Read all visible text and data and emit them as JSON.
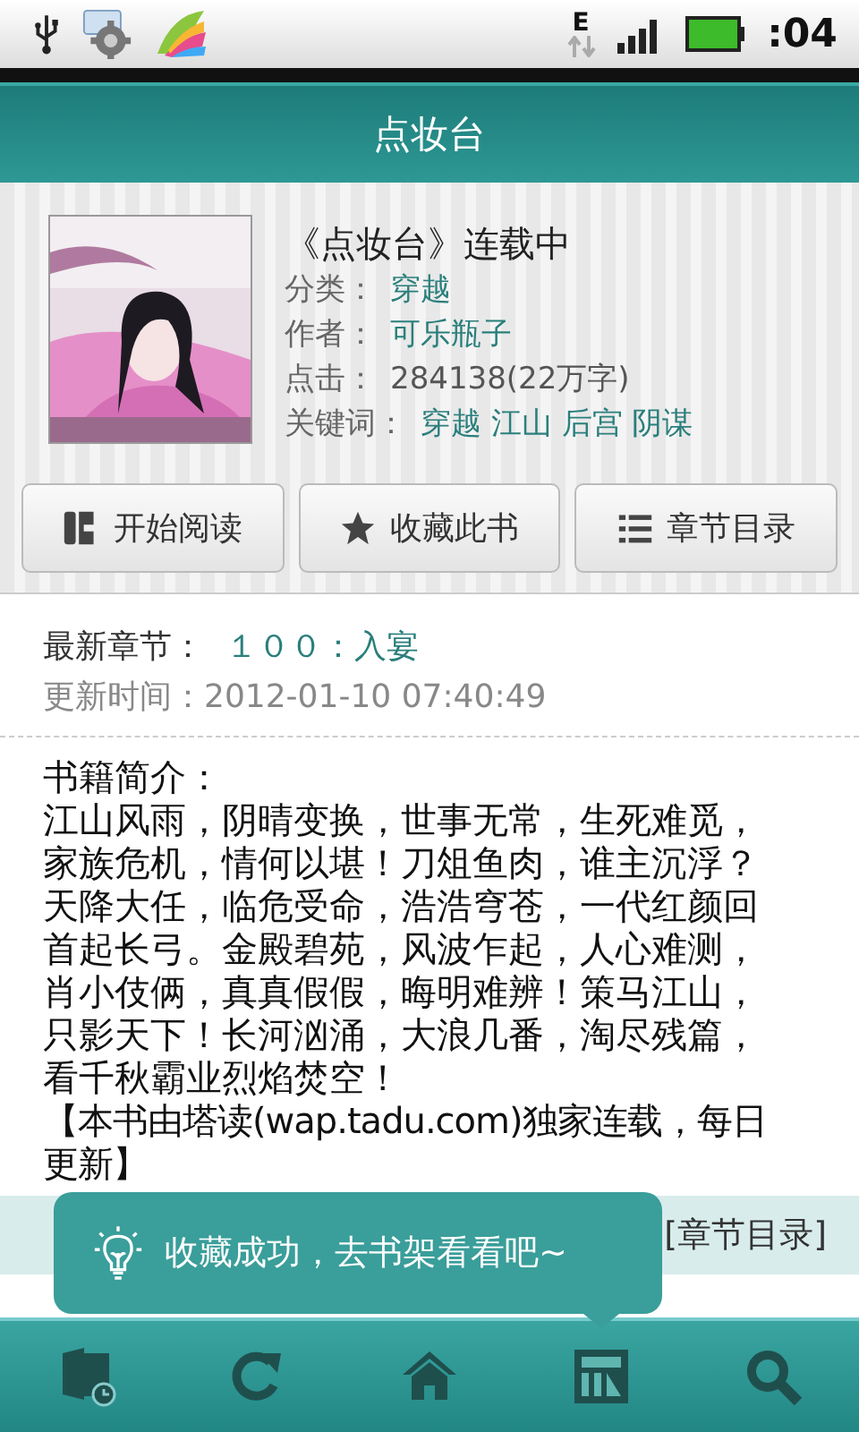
{
  "status_bar": {
    "network": "E",
    "time": ":04"
  },
  "title": "点妆台",
  "book": {
    "heading": "《点妆台》连载中",
    "fields": [
      {
        "label": "分类：",
        "value": "穿越",
        "kind": "link"
      },
      {
        "label": "作者：",
        "value": "可乐瓶子",
        "kind": "link"
      },
      {
        "label": "点击：",
        "value": "284138(22万字)",
        "kind": "plain"
      },
      {
        "label": "关键词：",
        "value": "穿越 江山 后宫 阴谋",
        "kind": "link"
      }
    ]
  },
  "buttons": [
    {
      "label": "开始阅读"
    },
    {
      "label": "收藏此书"
    },
    {
      "label": "章节目录"
    }
  ],
  "latest": {
    "label": "最新章节：",
    "chapter": "１００：入宴",
    "updated": "更新时间：2012-01-10 07:40:49"
  },
  "intro": {
    "heading": "书籍简介：",
    "paragraphs": [
      "江山风雨，阴晴变换，世事无常，生死难觅，家族危机，情何以堪！刀俎鱼肉，谁主沉浮？天降大任，临危受命，浩浩穹苍，一代红颜回首起长弓。金殿碧苑，风波乍起，人心难测，肖小伎俩，真真假假，晦明难辨！策马江山，只影天下！长河汹涌，大浪几番，淘尽残篇，看千秋霸业烈焰焚空！",
      "【本书由塔读(wap.tadu.com)独家连载，每日更新】"
    ]
  },
  "chapters_bar": {
    "link": "[章节目录]"
  },
  "popup": {
    "text": "收藏成功，去书架看看吧~"
  }
}
